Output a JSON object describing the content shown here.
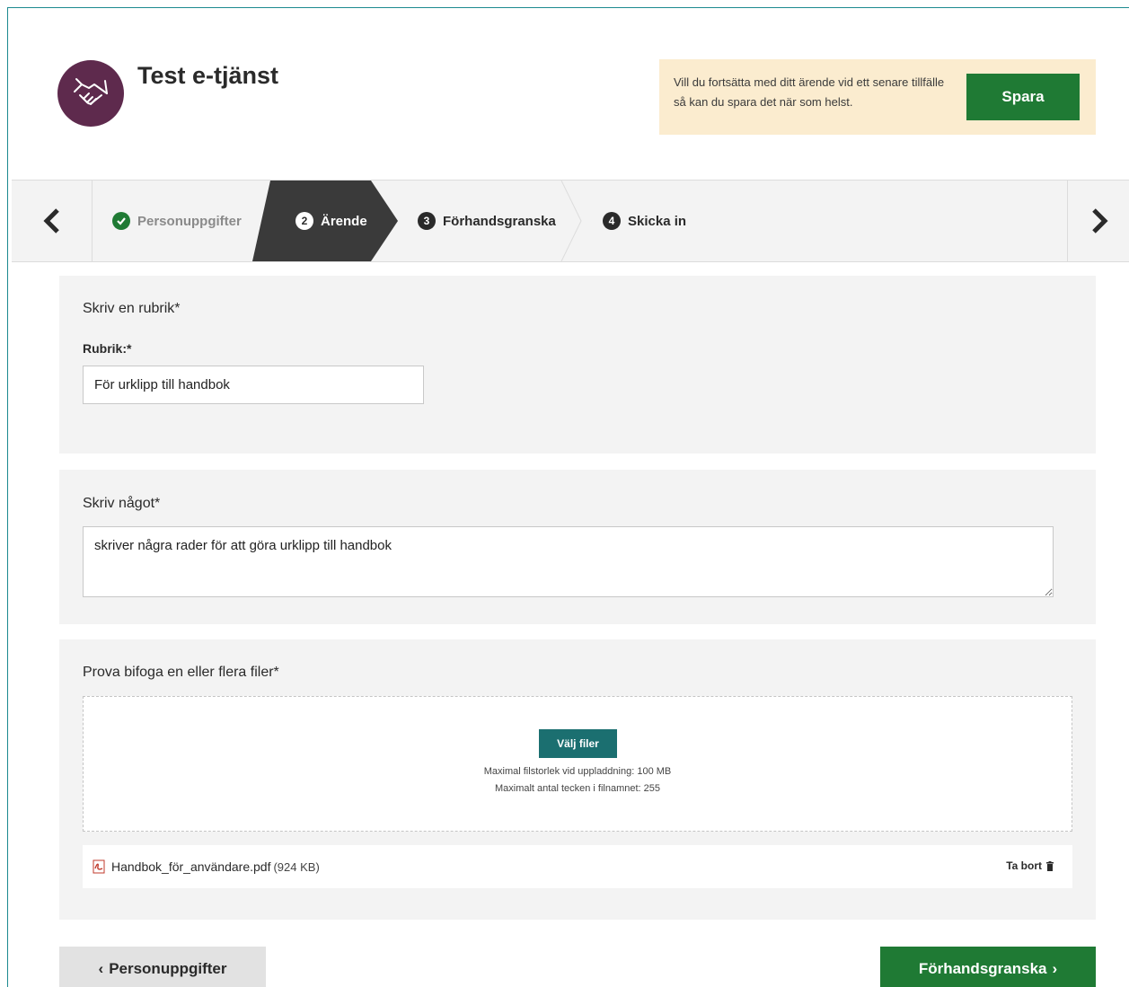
{
  "header": {
    "title": "Test e-tjänst",
    "logo_icon": "handshake-icon",
    "save_banner_text": "Vill du fortsätta med ditt ärende vid ett senare tillfälle så kan du spara det när som helst.",
    "save_label": "Spara"
  },
  "stepper": {
    "prev_icon": "chevron-left-icon",
    "next_icon": "chevron-right-icon",
    "steps": [
      {
        "num": "✓",
        "label": "Personuppgifter",
        "state": "done"
      },
      {
        "num": "2",
        "label": "Ärende",
        "state": "active"
      },
      {
        "num": "3",
        "label": "Förhandsgranska",
        "state": "upcoming"
      },
      {
        "num": "4",
        "label": "Skicka in",
        "state": "upcoming"
      }
    ]
  },
  "section_title": {
    "heading": "Skriv en rubrik*",
    "field_label": "Rubrik:*",
    "value": "För urklipp till handbok"
  },
  "section_text": {
    "heading": "Skriv något*",
    "value": "skriver några rader för att göra urklipp till handbok"
  },
  "section_files": {
    "heading": "Prova bifoga en eller flera filer*",
    "choose_label": "Välj filer",
    "max_size": "Maximal filstorlek vid uppladdning: 100 MB",
    "max_chars": "Maximalt antal tecken i filnamnet: 255",
    "file": {
      "name": "Handbok_för_användare.pdf",
      "size": "(924 KB)",
      "remove_label": "Ta bort"
    }
  },
  "footer": {
    "back_label": "Personuppgifter",
    "next_label": "Förhandsgranska"
  },
  "colors": {
    "primary_green": "#1f7a34",
    "teal": "#1b6f70",
    "logo_purple": "#5e2a4d",
    "banner_bg": "#fbeccf"
  }
}
